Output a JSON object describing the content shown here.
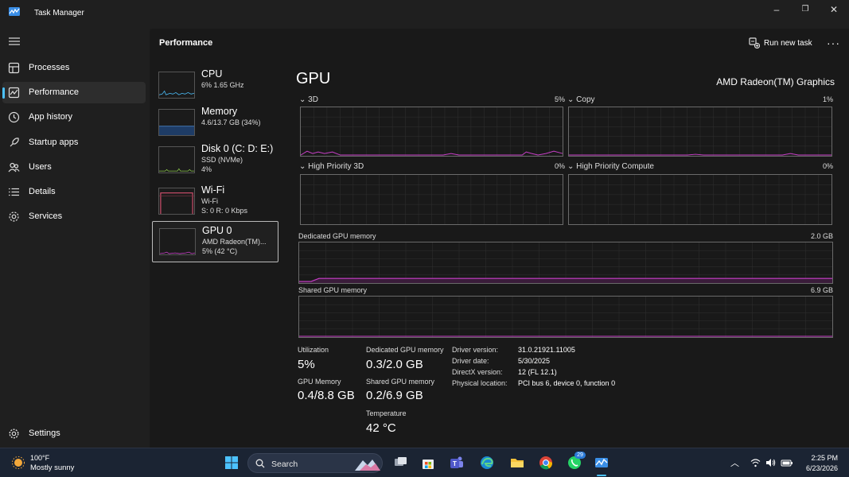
{
  "window": {
    "title": "Task Manager"
  },
  "nav": {
    "items": [
      {
        "label": "Processes",
        "icon": "processes-icon"
      },
      {
        "label": "Performance",
        "icon": "performance-icon",
        "active": true
      },
      {
        "label": "App history",
        "icon": "app-history-icon"
      },
      {
        "label": "Startup apps",
        "icon": "startup-apps-icon"
      },
      {
        "label": "Users",
        "icon": "users-icon"
      },
      {
        "label": "Details",
        "icon": "details-icon"
      },
      {
        "label": "Services",
        "icon": "services-icon"
      }
    ],
    "settings_label": "Settings"
  },
  "header": {
    "title": "Performance",
    "run_new_task": "Run new task"
  },
  "devices": [
    {
      "name": "CPU",
      "sub1": "6% 1.65 GHz",
      "sub2": ""
    },
    {
      "name": "Memory",
      "sub1": "4.6/13.7 GB (34%)",
      "sub2": ""
    },
    {
      "name": "Disk 0 (C: D: E:)",
      "sub1": "SSD (NVMe)",
      "sub2": "4%"
    },
    {
      "name": "Wi-Fi",
      "sub1": "Wi-Fi",
      "sub2": "S: 0 R: 0 Kbps"
    },
    {
      "name": "GPU 0",
      "sub1": "AMD Radeon(TM)...",
      "sub2": "5% (42 °C)",
      "selected": true
    }
  ],
  "gpu": {
    "title": "GPU",
    "model": "AMD Radeon(TM) Graphics",
    "engines": [
      {
        "label": "3D",
        "percent": "5%"
      },
      {
        "label": "Copy",
        "percent": "1%"
      },
      {
        "label": "High Priority 3D",
        "percent": "0%"
      },
      {
        "label": "High Priority Compute",
        "percent": "0%"
      }
    ],
    "dedicated": {
      "label": "Dedicated GPU memory",
      "max": "2.0 GB"
    },
    "shared": {
      "label": "Shared GPU memory",
      "max": "6.9 GB"
    },
    "stats": {
      "utilization_label": "Utilization",
      "utilization": "5%",
      "dedicated_label": "Dedicated GPU memory",
      "dedicated": "0.3/2.0 GB",
      "gpu_memory_label": "GPU Memory",
      "gpu_memory": "0.4/8.8 GB",
      "shared_label": "Shared GPU memory",
      "shared": "0.2/6.9 GB",
      "temperature_label": "Temperature",
      "temperature": "42 °C"
    },
    "info": [
      {
        "key": "Driver version:",
        "value": "31.0.21921.11005"
      },
      {
        "key": "Driver date:",
        "value": "5/30/2025"
      },
      {
        "key": "DirectX version:",
        "value": "12 (FL 12.1)"
      },
      {
        "key": "Physical location:",
        "value": "PCI bus 6, device 0, function 0"
      }
    ]
  },
  "taskbar": {
    "weather_temp": "100°F",
    "weather_desc": "Mostly sunny",
    "search_label": "Search",
    "badge_count": "29",
    "time": "2:25 PM",
    "date": "6/23/2026"
  },
  "colors": {
    "accent": "#4cc2ff",
    "gpu_line": "#c83fc8",
    "wifi_line": "#d4506e"
  }
}
